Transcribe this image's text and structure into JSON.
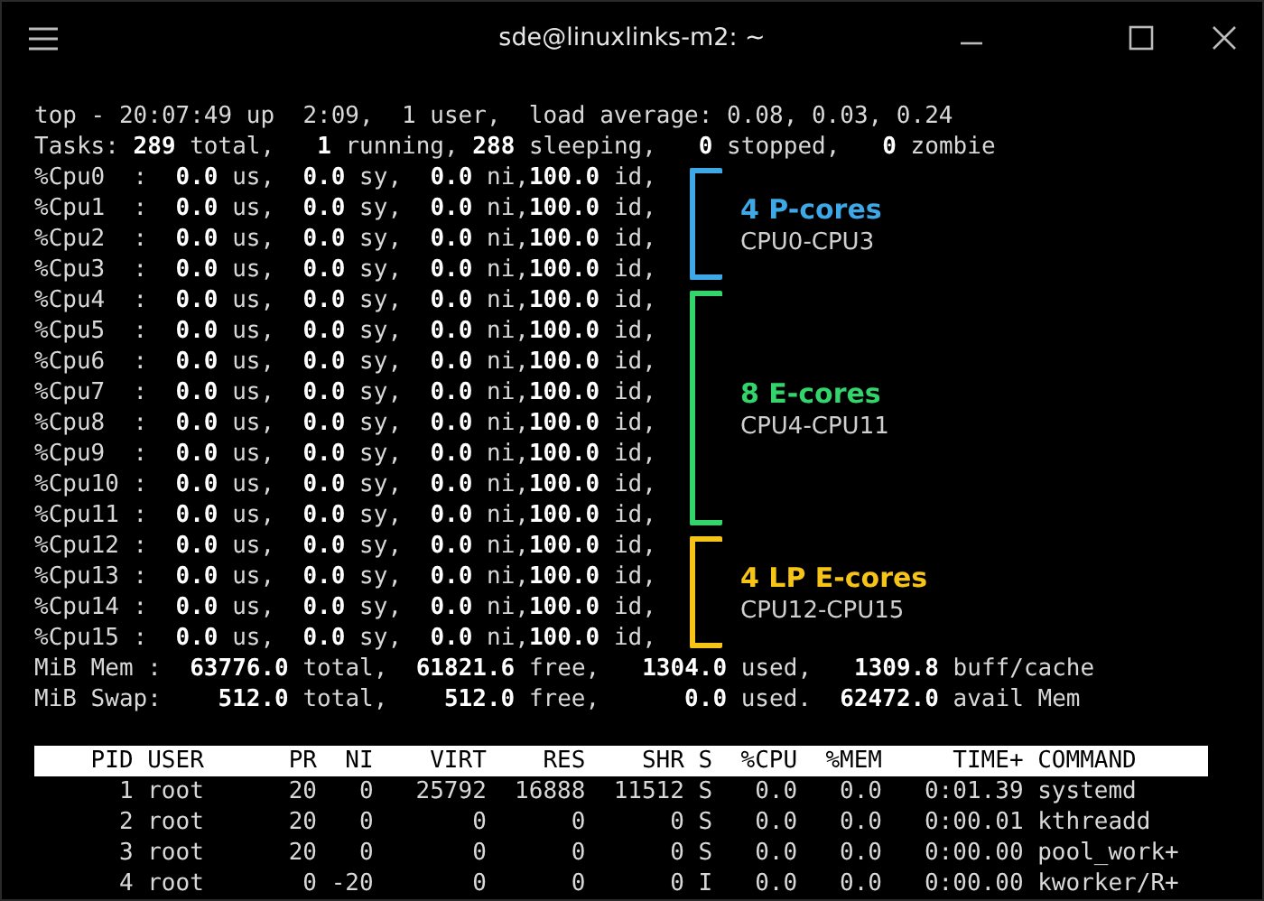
{
  "window": {
    "title": "sde@linuxlinks-m2: ~"
  },
  "summary_lines": [
    "top - 20:07:49 up  2:09,  1 user,  load average: 0.08, 0.03, 0.24",
    "Tasks: **289** total,   **1** running, **288** sleeping,   **0** stopped,   **0** zombie"
  ],
  "core_groups": [
    {
      "title": "4 P-cores",
      "range": "CPU0-CPU3",
      "color": "#3ea8e6",
      "cpu_lines": [
        "%Cpu0  :  **0.0** us,  **0.0** sy,  **0.0** ni,**100.0** id,",
        "%Cpu1  :  **0.0** us,  **0.0** sy,  **0.0** ni,**100.0** id,",
        "%Cpu2  :  **0.0** us,  **0.0** sy,  **0.0** ni,**100.0** id,",
        "%Cpu3  :  **0.0** us,  **0.0** sy,  **0.0** ni,**100.0** id,"
      ]
    },
    {
      "title": "8 E-cores",
      "range": "CPU4-CPU11",
      "color": "#33d46c",
      "cpu_lines": [
        "%Cpu4  :  **0.0** us,  **0.0** sy,  **0.0** ni,**100.0** id,",
        "%Cpu5  :  **0.0** us,  **0.0** sy,  **0.0** ni,**100.0** id,",
        "%Cpu6  :  **0.0** us,  **0.0** sy,  **0.0** ni,**100.0** id,",
        "%Cpu7  :  **0.0** us,  **0.0** sy,  **0.0** ni,**100.0** id,",
        "%Cpu8  :  **0.0** us,  **0.0** sy,  **0.0** ni,**100.0** id,",
        "%Cpu9  :  **0.0** us,  **0.0** sy,  **0.0** ni,**100.0** id,",
        "%Cpu10 :  **0.0** us,  **0.0** sy,  **0.0** ni,**100.0** id,",
        "%Cpu11 :  **0.0** us,  **0.0** sy,  **0.0** ni,**100.0** id,"
      ]
    },
    {
      "title": "4 LP E-cores",
      "range": "CPU12-CPU15",
      "color": "#f6c416",
      "cpu_lines": [
        "%Cpu12 :  **0.0** us,  **0.0** sy,  **0.0** ni,**100.0** id,",
        "%Cpu13 :  **0.0** us,  **0.0** sy,  **0.0** ni,**100.0** id,",
        "%Cpu14 :  **0.0** us,  **0.0** sy,  **0.0** ni,**100.0** id,",
        "%Cpu15 :  **0.0** us,  **0.0** sy,  **0.0** ni,**100.0** id,"
      ]
    }
  ],
  "memory_lines": [
    "MiB Mem :  **63776.0** total,  **61821.6** free,   **1304.0** used,   **1309.8** buff/cache",
    "MiB Swap:    **512.0** total,    **512.0** free,      **0.0** used.  **62472.0** avail Mem"
  ],
  "process_table": {
    "columns": [
      "PID",
      "USER",
      "PR",
      "NI",
      "VIRT",
      "RES",
      "SHR",
      "S",
      "%CPU",
      "%MEM",
      "TIME+",
      "COMMAND"
    ],
    "rows": [
      [
        "1",
        "root",
        "20",
        "0",
        "25792",
        "16888",
        "11512",
        "S",
        "0.0",
        "0.0",
        "0:01.39",
        "systemd"
      ],
      [
        "2",
        "root",
        "20",
        "0",
        "0",
        "0",
        "0",
        "S",
        "0.0",
        "0.0",
        "0:00.01",
        "kthreadd"
      ],
      [
        "3",
        "root",
        "20",
        "0",
        "0",
        "0",
        "0",
        "S",
        "0.0",
        "0.0",
        "0:00.00",
        "pool_work+"
      ],
      [
        "4",
        "root",
        "0",
        "-20",
        "0",
        "0",
        "0",
        "I",
        "0.0",
        "0.0",
        "0:00.00",
        "kworker/R+"
      ]
    ]
  }
}
